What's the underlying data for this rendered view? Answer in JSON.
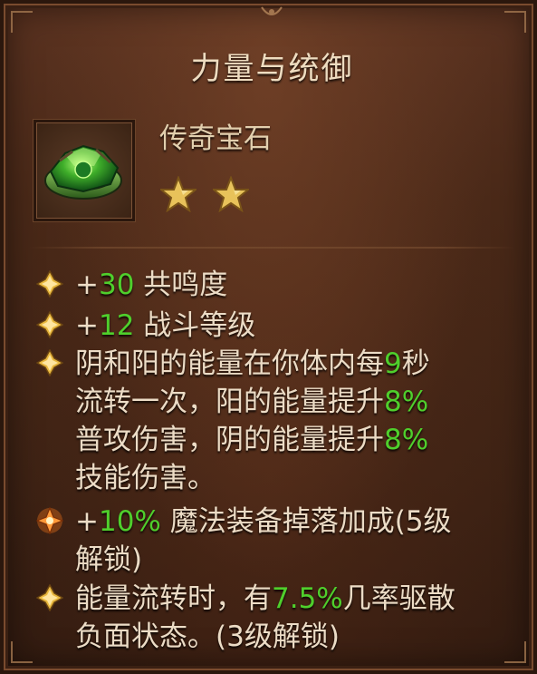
{
  "title": "力量与统御",
  "item": {
    "type": "传奇宝石",
    "stars": 2,
    "max_stars_shown": 2,
    "icon": "green-gem-ring-icon"
  },
  "colors": {
    "highlight": "#4fcf2c",
    "text": "#ecdcc6",
    "title": "#eedcc0",
    "star": "#e8c25a"
  },
  "attributes": [
    {
      "bullet": "gold-diamond-icon",
      "lines": [
        [
          {
            "t": "+"
          },
          {
            "t": "30",
            "hl": true
          },
          {
            "t": " 共鸣度"
          }
        ]
      ]
    },
    {
      "bullet": "gold-diamond-icon",
      "lines": [
        [
          {
            "t": "+"
          },
          {
            "t": "12",
            "hl": true
          },
          {
            "t": " 战斗等级"
          }
        ]
      ]
    },
    {
      "bullet": "gold-diamond-icon",
      "lines": [
        [
          {
            "t": "阴和阳的能量在你体内每"
          },
          {
            "t": "9",
            "hl": true
          },
          {
            "t": "秒"
          }
        ],
        [
          {
            "t": "流转一次，阳的能量提升"
          },
          {
            "t": "8%",
            "hl": true
          }
        ],
        [
          {
            "t": "普攻伤害，阴的能量提升"
          },
          {
            "t": "8%",
            "hl": true
          }
        ],
        [
          {
            "t": "技能伤害。"
          }
        ]
      ]
    },
    {
      "bullet": "glowing-star-icon",
      "lines": [
        [
          {
            "t": "+"
          },
          {
            "t": "10%",
            "hl": true
          },
          {
            "t": " 魔法装备掉落加成(5级"
          }
        ],
        [
          {
            "t": "解锁)"
          }
        ]
      ]
    },
    {
      "bullet": "gold-diamond-icon",
      "lines": [
        [
          {
            "t": "能量流转时，有"
          },
          {
            "t": "7.5%",
            "hl": true
          },
          {
            "t": "几率驱散"
          }
        ],
        [
          {
            "t": "负面状态。(3级解锁)"
          }
        ]
      ]
    }
  ]
}
